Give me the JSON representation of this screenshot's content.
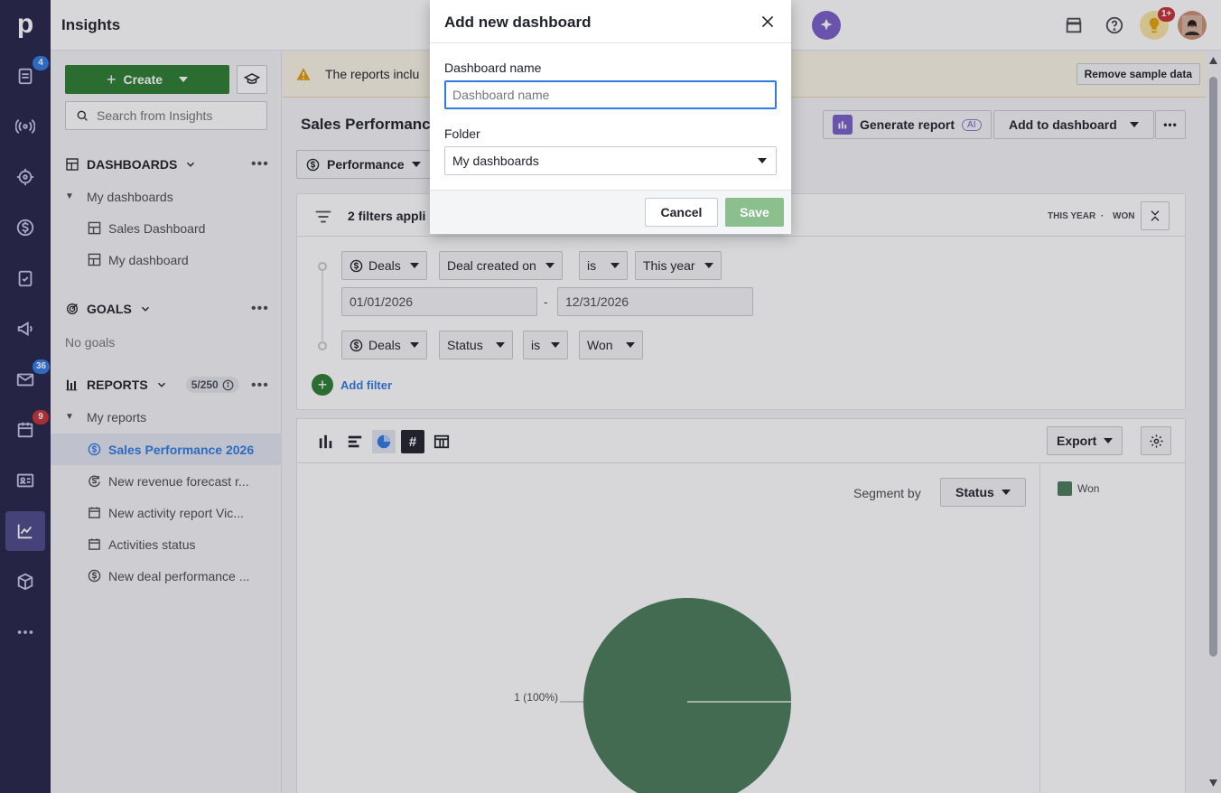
{
  "app": {
    "title": "Insights"
  },
  "rail": {
    "badges": {
      "deals": "4",
      "mail": "36",
      "calendar": "9"
    }
  },
  "topbar": {
    "notification_badge": "1+"
  },
  "sidebar": {
    "create_label": "Create",
    "search_placeholder": "Search from Insights",
    "dashboards": {
      "title": "DASHBOARDS",
      "folder": "My dashboards",
      "items": [
        "Sales Dashboard",
        "My dashboard"
      ]
    },
    "goals": {
      "title": "GOALS",
      "empty": "No goals"
    },
    "reports": {
      "title": "REPORTS",
      "count": "5/250",
      "folder": "My reports",
      "items": [
        "Sales Performance 2026",
        "New revenue forecast r...",
        "New activity report Vic...",
        "Activities status",
        "New deal performance ..."
      ]
    }
  },
  "main": {
    "warning_text": "The reports inclu",
    "remove_sample": "Remove sample data",
    "report_title": "Sales Performance",
    "report_type": "Performance",
    "generate_report": "Generate report",
    "ai_badge": "AI",
    "add_to_dashboard": "Add to dashboard",
    "filters": {
      "summary": "2 filters appli",
      "tag_period": "THIS YEAR",
      "tag_status": "WON",
      "row1": {
        "entity": "Deals",
        "field": "Deal created on",
        "operator": "is",
        "value": "This year"
      },
      "date_from": "01/01/2026",
      "date_sep": "-",
      "date_to": "12/31/2026",
      "row2": {
        "entity": "Deals",
        "field": "Status",
        "operator": "is",
        "value": "Won"
      },
      "add_filter": "Add filter"
    },
    "export_label": "Export",
    "segment_label": "Segment by",
    "segment_value": "Status"
  },
  "chart_data": {
    "type": "pie",
    "categories": [
      "Won"
    ],
    "values": [
      1
    ],
    "data_labels": [
      "1 (100%)"
    ],
    "legend": [
      "Won"
    ],
    "legend_position": "right",
    "colors": [
      "#4a7c59"
    ]
  },
  "modal": {
    "title": "Add new dashboard",
    "name_label": "Dashboard name",
    "name_placeholder": "Dashboard name",
    "folder_label": "Folder",
    "folder_value": "My dashboards",
    "cancel": "Cancel",
    "save": "Save"
  }
}
